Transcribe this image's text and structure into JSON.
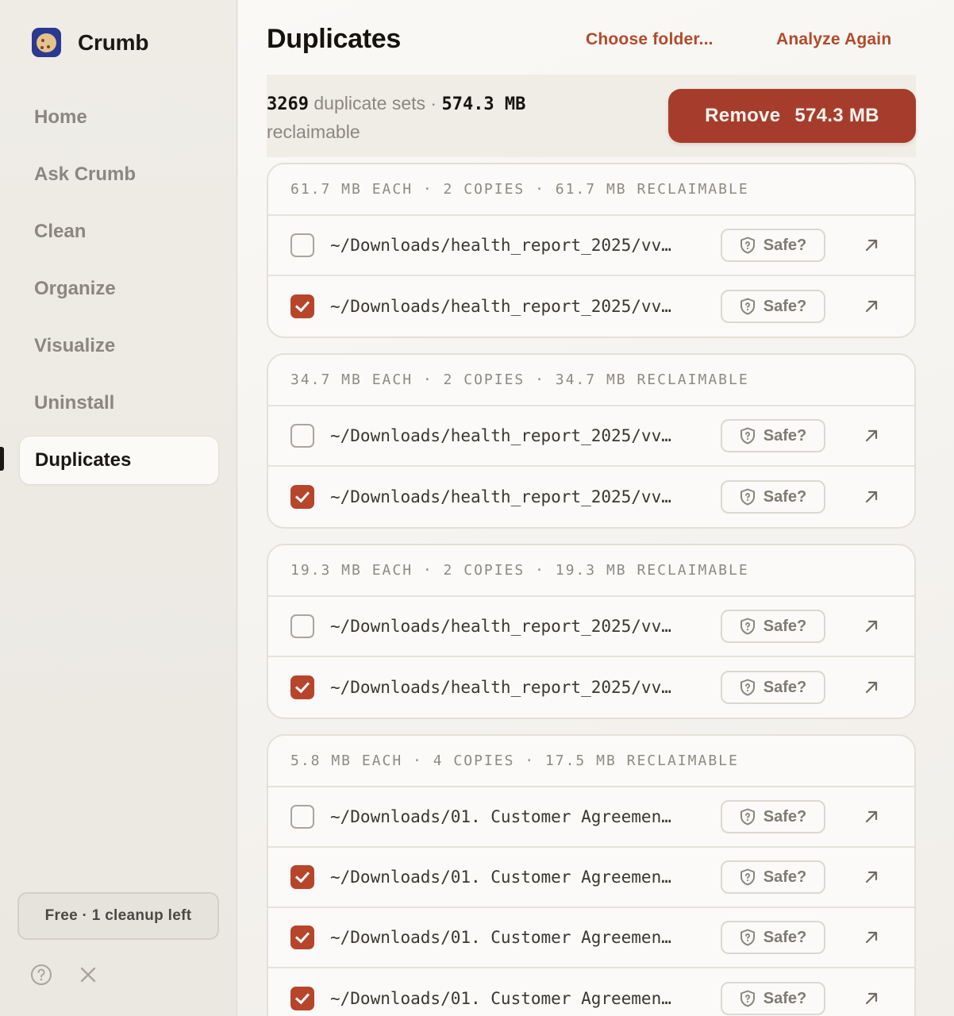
{
  "app": {
    "name": "Crumb",
    "logo_icon": "cookie-icon"
  },
  "sidebar": {
    "items": [
      {
        "label": "Home",
        "active": false
      },
      {
        "label": "Ask Crumb",
        "active": false
      },
      {
        "label": "Clean",
        "active": false
      },
      {
        "label": "Organize",
        "active": false
      },
      {
        "label": "Visualize",
        "active": false
      },
      {
        "label": "Uninstall",
        "active": false
      },
      {
        "label": "Duplicates",
        "active": true
      }
    ],
    "plan_badge": "Free · 1 cleanup left",
    "help_icon": "help-circle-icon",
    "close_icon": "close-icon"
  },
  "header": {
    "title": "Duplicates",
    "choose_folder": "Choose folder...",
    "analyze_again": "Analyze Again"
  },
  "summary": {
    "set_count": "3269",
    "sets_label": " duplicate sets · ",
    "total_size": "574.3 MB",
    "reclaimable_label": "reclaimable",
    "remove_label": "Remove",
    "remove_size": "574.3 MB"
  },
  "groups": [
    {
      "header": "61.7 MB EACH · 2 COPIES · 61.7 MB RECLAIMABLE",
      "rows": [
        {
          "path": "~/Downloads/health_report_2025/vv…",
          "checked": false,
          "safe_label": "Safe?"
        },
        {
          "path": "~/Downloads/health_report_2025/vv…",
          "checked": true,
          "safe_label": "Safe?"
        }
      ]
    },
    {
      "header": "34.7 MB EACH · 2 COPIES · 34.7 MB RECLAIMABLE",
      "rows": [
        {
          "path": "~/Downloads/health_report_2025/vv…",
          "checked": false,
          "safe_label": "Safe?"
        },
        {
          "path": "~/Downloads/health_report_2025/vv…",
          "checked": true,
          "safe_label": "Safe?"
        }
      ]
    },
    {
      "header": "19.3 MB EACH · 2 COPIES · 19.3 MB RECLAIMABLE",
      "rows": [
        {
          "path": "~/Downloads/health_report_2025/vv…",
          "checked": false,
          "safe_label": "Safe?"
        },
        {
          "path": "~/Downloads/health_report_2025/vv…",
          "checked": true,
          "safe_label": "Safe?"
        }
      ]
    },
    {
      "header": "5.8 MB EACH · 4 COPIES · 17.5 MB RECLAIMABLE",
      "rows": [
        {
          "path": "~/Downloads/01. Customer Agreemen…",
          "checked": false,
          "safe_label": "Safe?"
        },
        {
          "path": "~/Downloads/01. Customer Agreemen…",
          "checked": true,
          "safe_label": "Safe?"
        },
        {
          "path": "~/Downloads/01. Customer Agreemen…",
          "checked": true,
          "safe_label": "Safe?"
        },
        {
          "path": "~/Downloads/01. Customer Agreemen…",
          "checked": true,
          "safe_label": "Safe?"
        }
      ]
    }
  ],
  "colors": {
    "accent": "#b24a2a",
    "remove_button": "#a63d2c",
    "checkbox_checked": "#b6452b",
    "logo_bg": "#2b3990"
  }
}
